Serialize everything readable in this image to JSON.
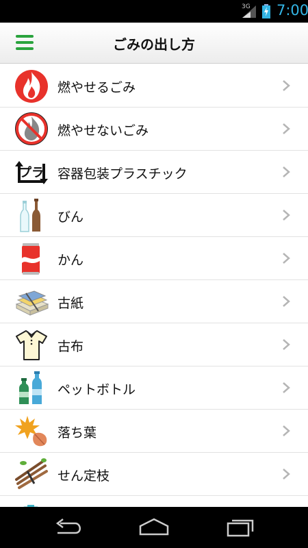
{
  "status_bar": {
    "network": "3G",
    "time": "7:00"
  },
  "header": {
    "title": "ごみの出し方"
  },
  "items": [
    {
      "label": "燃やせるごみ"
    },
    {
      "label": "燃やせないごみ"
    },
    {
      "label": "容器包装プラスチック"
    },
    {
      "label": "びん"
    },
    {
      "label": "かん"
    },
    {
      "label": "古紙"
    },
    {
      "label": "古布"
    },
    {
      "label": "ペットボトル"
    },
    {
      "label": "落ち葉"
    },
    {
      "label": "せん定枝"
    }
  ],
  "colors": {
    "accent": "#2aa33d",
    "time": "#33b5e5"
  }
}
